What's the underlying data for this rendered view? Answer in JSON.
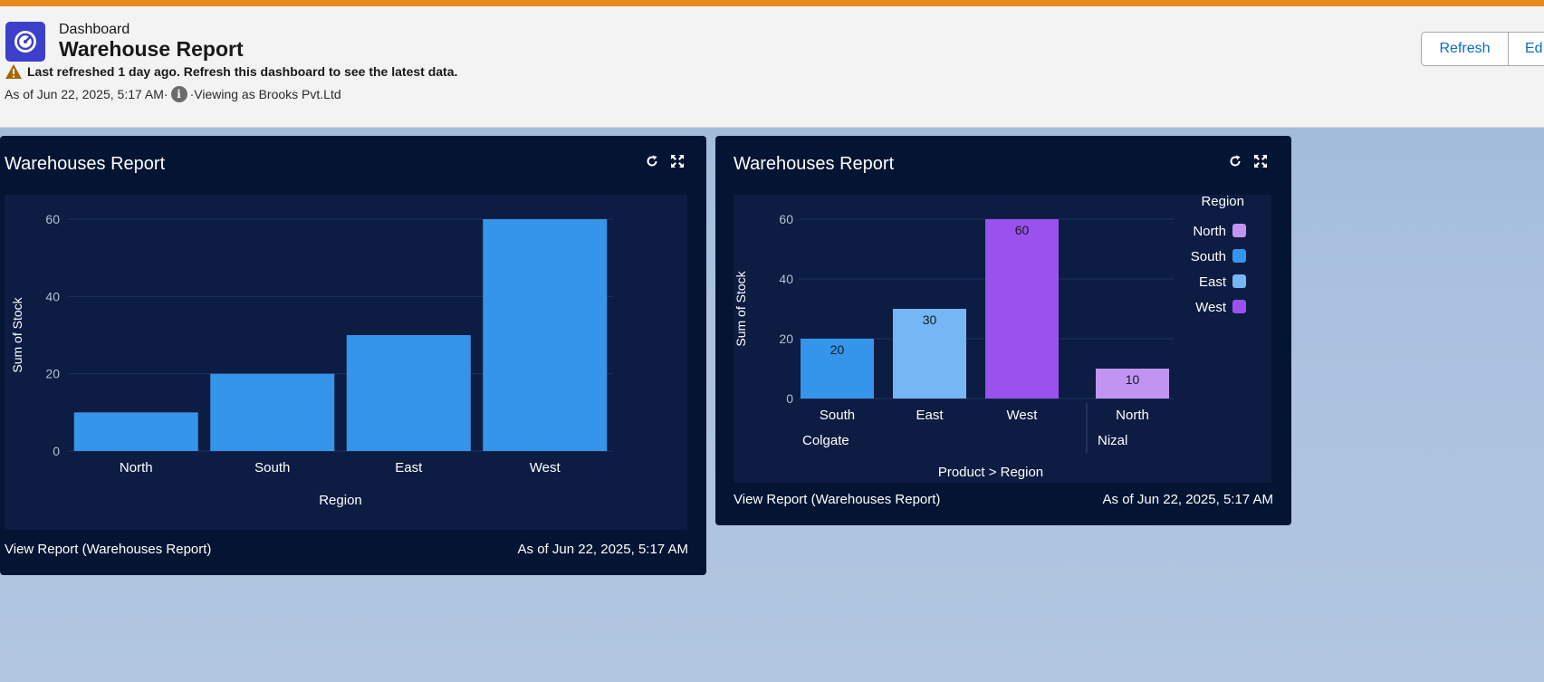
{
  "header": {
    "breadcrumb": "Dashboard",
    "title": "Warehouse Report",
    "warning": "Last refreshed 1 day ago. Refresh this dashboard to see the latest data.",
    "as_of": "As of Jun 22, 2025, 5:17 AM",
    "separator": "·",
    "viewing_as": "Viewing as Brooks Pvt.Ltd",
    "icons": {
      "app": "dashboard-gauge-icon",
      "warning": "warning-triangle-icon",
      "info": "info-icon"
    },
    "buttons": {
      "refresh": "Refresh",
      "edit": "Ed"
    }
  },
  "colors": {
    "accent": "#e8891e",
    "card_bg": "#031533",
    "chart_bg": "#0c1c42",
    "bar_blue": "#3595ea",
    "north": "#c294f2",
    "south": "#3595ea",
    "east": "#74b7f4",
    "west": "#9b51ee"
  },
  "cards": [
    {
      "title": "Warehouses Report",
      "footer_link": "View Report (Warehouses Report)",
      "footer_time": "As of Jun 22, 2025, 5:17 AM",
      "icons": [
        "refresh-icon",
        "expand-icon"
      ]
    },
    {
      "title": "Warehouses Report",
      "footer_link": "View Report (Warehouses Report)",
      "footer_time": "As of Jun 22, 2025, 5:17 AM",
      "icons": [
        "refresh-icon",
        "expand-icon"
      ]
    }
  ],
  "chart_data": [
    {
      "type": "bar",
      "categories": [
        "North",
        "South",
        "East",
        "West"
      ],
      "values": [
        10,
        20,
        30,
        60
      ],
      "xlabel": "Region",
      "ylabel": "Sum of Stock",
      "ylim": [
        0,
        60
      ],
      "yticks": [
        0,
        20,
        40,
        60
      ],
      "grid": true
    },
    {
      "type": "bar",
      "xlabel": "Product  >  Region",
      "ylabel": "Sum of Stock",
      "ylim": [
        0,
        60
      ],
      "yticks": [
        0,
        20,
        40,
        60
      ],
      "grid": true,
      "legend": {
        "title": "Region",
        "position": "top-right",
        "items": [
          "North",
          "South",
          "East",
          "West"
        ]
      },
      "groups": [
        {
          "product": "Colgate",
          "bars": [
            {
              "region": "South",
              "value": 20
            },
            {
              "region": "East",
              "value": 30
            },
            {
              "region": "West",
              "value": 60
            }
          ]
        },
        {
          "product": "Nizal",
          "bars": [
            {
              "region": "North",
              "value": 10
            }
          ]
        }
      ]
    }
  ]
}
